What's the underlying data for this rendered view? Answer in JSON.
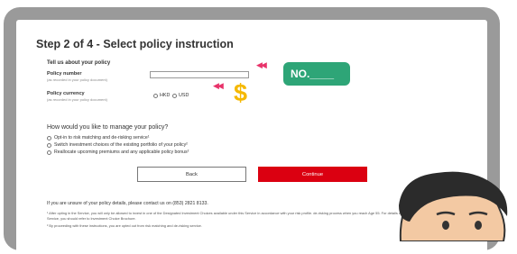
{
  "page": {
    "title": "Step 2 of 4 - Select policy instruction",
    "tell_us": "Tell us about your policy"
  },
  "policy_number": {
    "label": "Policy number",
    "hint": "(as recorded in your policy document)",
    "value": ""
  },
  "policy_currency": {
    "label": "Policy currency",
    "hint": "(as recorded in your policy document)",
    "options": [
      "HKD",
      "USD"
    ]
  },
  "manage": {
    "title": "How would you like to manage your policy?",
    "options": [
      "Opt-in to risk matching and de-risking service¹",
      "Switch investment choices of the existing portfolio of your policy²",
      "Reallocate upcoming premiums and any applicable policy bonus²"
    ]
  },
  "buttons": {
    "back": "Back",
    "continue": "Continue"
  },
  "help": {
    "unsure": "If you are unsure of your policy details, please contact us on (853) 2821 8133.",
    "footnote1": "¹ After opting in the Service, you will only be allowed to invest in one of the Designated Investment Choices available under this Service in accordance with your risk profile. de-risking process when you reach Age 55. For details of the Service, you should refer to Investment Choice Brochure.",
    "footnote2": "² By proceeding with these instructions, you are opted out from risk matching and de-risking service."
  },
  "annotations": {
    "no_label": "NO.____",
    "dollar": "$",
    "arrow": "◀◀"
  },
  "colors": {
    "accent": "#db0011",
    "badge": "#2ea577",
    "dollar": "#f5b800",
    "arrow": "#e8336a"
  }
}
